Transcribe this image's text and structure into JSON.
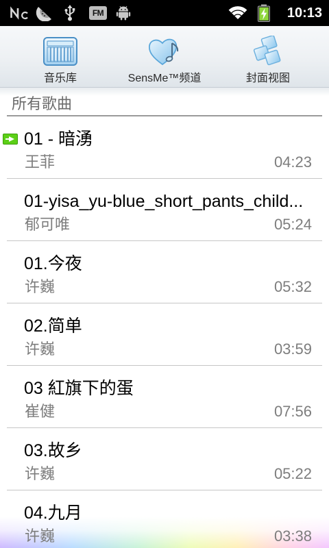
{
  "status_bar": {
    "time": "10:13",
    "fm_label": "FM",
    "icons": [
      "nc-icon",
      "watermelon-icon",
      "usb-icon",
      "fm-radio-icon",
      "android-icon",
      "wifi-icon",
      "battery-charging-icon"
    ]
  },
  "tabs": [
    {
      "label": "音乐库",
      "icon": "music-library-icon"
    },
    {
      "label": "SensMe™频道",
      "icon": "sensme-channel-icon"
    },
    {
      "label": "封面视图",
      "icon": "cover-view-icon"
    }
  ],
  "section": {
    "title": "所有歌曲"
  },
  "songs": [
    {
      "title": "01 - 暗湧",
      "artist": "王菲",
      "duration": "04:23",
      "now_playing": true
    },
    {
      "title": "01-yisa_yu-blue_short_pants_child...",
      "artist": "郁可唯",
      "duration": "05:24",
      "now_playing": false
    },
    {
      "title": "01.今夜",
      "artist": "许巍",
      "duration": "05:32",
      "now_playing": false
    },
    {
      "title": "02.简单",
      "artist": "许巍",
      "duration": "03:59",
      "now_playing": false
    },
    {
      "title": "03 紅旗下的蛋",
      "artist": "崔健",
      "duration": "07:56",
      "now_playing": false
    },
    {
      "title": "03.故乡",
      "artist": "许巍",
      "duration": "05:22",
      "now_playing": false
    },
    {
      "title": "04.九月",
      "artist": "许巍",
      "duration": "03:38",
      "now_playing": false
    }
  ],
  "colors": {
    "status_bar_bg": "#000000",
    "now_playing": "#5ccf17",
    "battery_charge": "#8fd63c",
    "tab_icon_blue": "#4a8fc6"
  }
}
